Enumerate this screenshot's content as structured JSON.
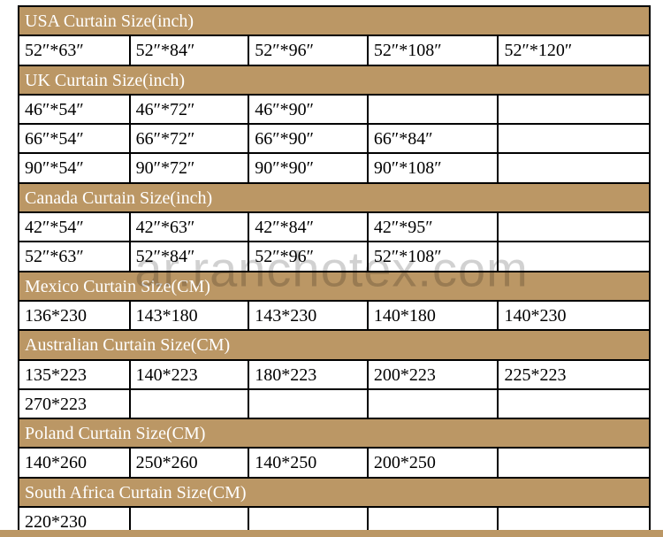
{
  "watermark": "ar.ranchotex.com",
  "columns": 5,
  "sections": [
    {
      "header": "USA Curtain Size(inch)",
      "rows": [
        [
          "52″*63″",
          "52″*84″",
          "52″*96″",
          "52″*108″",
          "52″*120″"
        ]
      ]
    },
    {
      "header": "UK Curtain Size(inch)",
      "rows": [
        [
          "46″*54″",
          "46″*72″",
          "46″*90″",
          "",
          ""
        ],
        [
          "66″*54″",
          "66″*72″",
          "66″*90″",
          "66″*84″",
          ""
        ],
        [
          "90″*54″",
          "90″*72″",
          "90″*90″",
          "90″*108″",
          ""
        ]
      ]
    },
    {
      "header": "Canada Curtain Size(inch)",
      "rows": [
        [
          "42″*54″",
          "42″*63″",
          "42″*84″",
          "42″*95″",
          ""
        ],
        [
          "52″*63″",
          "52″*84″",
          "52″*96″",
          "52″*108″",
          ""
        ]
      ]
    },
    {
      "header": "Mexico Curtain Size(CM)",
      "rows": [
        [
          "136*230",
          "143*180",
          "143*230",
          "140*180",
          "140*230"
        ]
      ]
    },
    {
      "header": "Australian Curtain Size(CM)",
      "rows": [
        [
          "135*223",
          "140*223",
          "180*223",
          "200*223",
          "225*223"
        ],
        [
          "270*223",
          "",
          "",
          "",
          ""
        ]
      ]
    },
    {
      "header": "Poland Curtain Size(CM)",
      "rows": [
        [
          "140*260",
          "250*260",
          "140*250",
          "200*250",
          ""
        ]
      ]
    },
    {
      "header": "South Africa Curtain Size(CM)",
      "rows": [
        [
          "220*230",
          "",
          "",
          "",
          ""
        ]
      ]
    }
  ]
}
